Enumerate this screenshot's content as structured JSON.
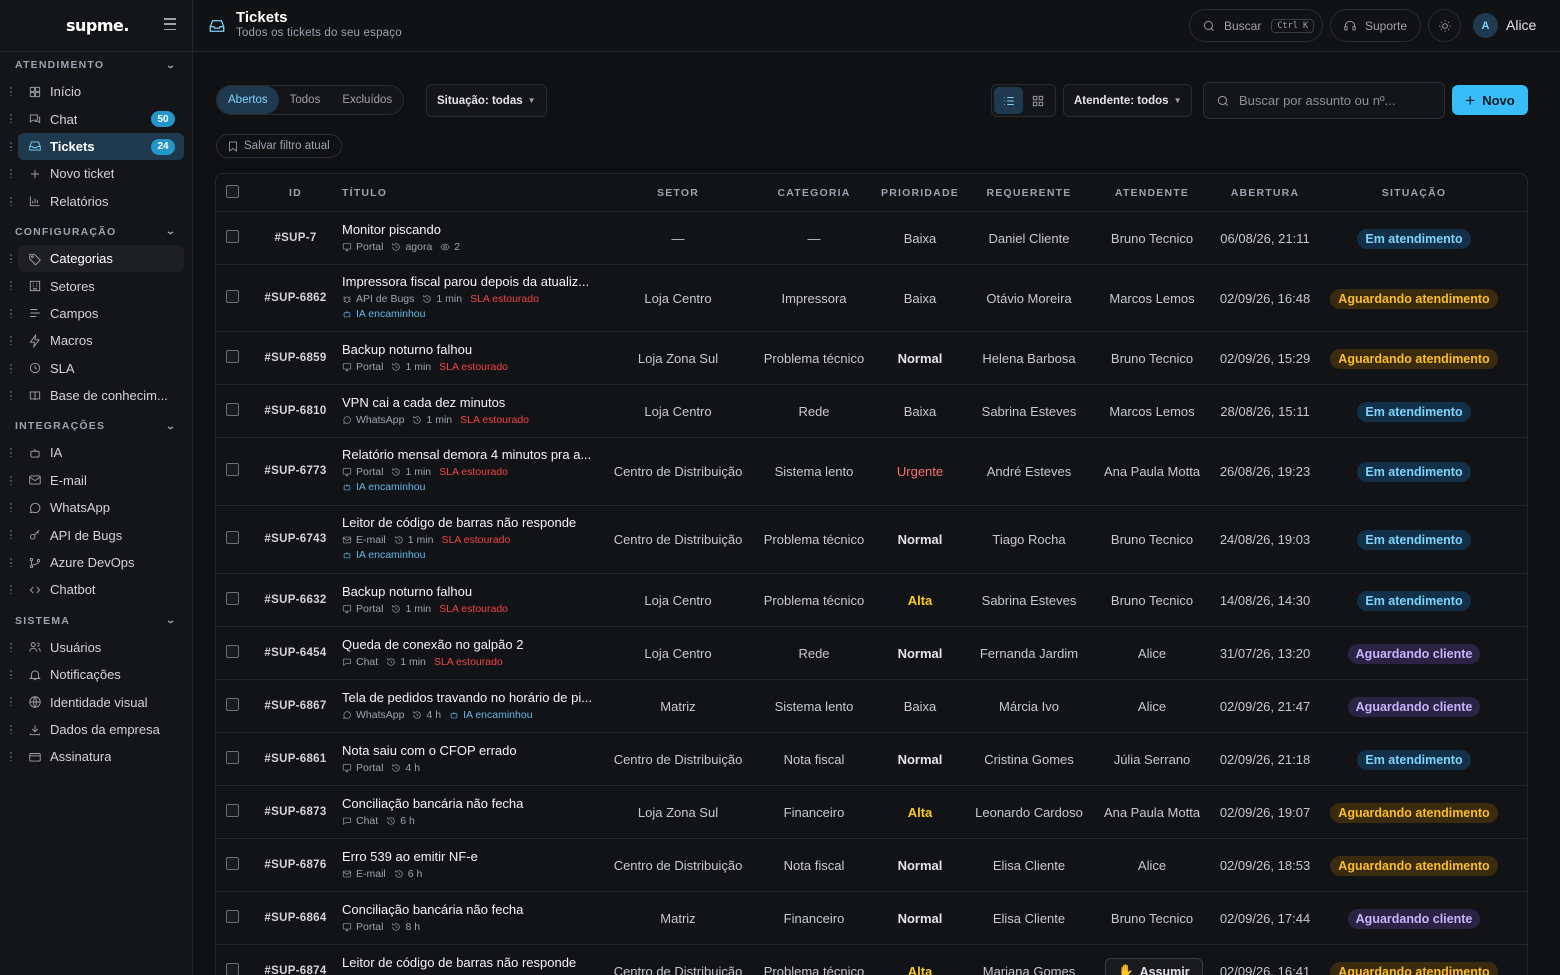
{
  "app": {
    "logo": "supme."
  },
  "sidebar": {
    "sections": [
      {
        "title": "ATENDIMENTO",
        "items": [
          {
            "label": "Início",
            "icon": "grid-icon"
          },
          {
            "label": "Chat",
            "icon": "chat-icon",
            "badge": "50"
          },
          {
            "label": "Tickets",
            "icon": "inbox-icon",
            "badge": "24",
            "active": true
          },
          {
            "label": "Novo ticket",
            "icon": "plus-icon"
          },
          {
            "label": "Relatórios",
            "icon": "bar-chart-icon"
          }
        ]
      },
      {
        "title": "CONFIGURAÇÃO",
        "items": [
          {
            "label": "Categorias",
            "icon": "tag-icon",
            "hover": true
          },
          {
            "label": "Setores",
            "icon": "building-icon"
          },
          {
            "label": "Campos",
            "icon": "fields-icon"
          },
          {
            "label": "Macros",
            "icon": "zap-icon"
          },
          {
            "label": "SLA",
            "icon": "clock-icon"
          },
          {
            "label": "Base de conhecim...",
            "icon": "book-icon"
          }
        ]
      },
      {
        "title": "INTEGRAÇÕES",
        "items": [
          {
            "label": "IA",
            "icon": "bot-icon"
          },
          {
            "label": "E-mail",
            "icon": "mail-icon"
          },
          {
            "label": "WhatsApp",
            "icon": "whatsapp-icon"
          },
          {
            "label": "API de Bugs",
            "icon": "key-icon"
          },
          {
            "label": "Azure DevOps",
            "icon": "git-branch-icon"
          },
          {
            "label": "Chatbot",
            "icon": "code-icon"
          }
        ]
      },
      {
        "title": "SISTEMA",
        "items": [
          {
            "label": "Usuários",
            "icon": "users-icon"
          },
          {
            "label": "Notificações",
            "icon": "bell-icon"
          },
          {
            "label": "Identidade visual",
            "icon": "globe-icon"
          },
          {
            "label": "Dados da empresa",
            "icon": "download-icon"
          },
          {
            "label": "Assinatura",
            "icon": "card-icon"
          }
        ]
      }
    ]
  },
  "header": {
    "title": "Tickets",
    "subtitle": "Todos os tickets do seu espaço",
    "search_label": "Buscar",
    "search_kbd": "Ctrl K",
    "support_label": "Suporte",
    "user_initial": "A",
    "user_name": "Alice"
  },
  "toolbar": {
    "tabs": [
      "Abertos",
      "Todos",
      "Excluídos"
    ],
    "status_filter": "Situação: todas",
    "agent_filter": "Atendente: todos",
    "search_placeholder": "Buscar por assunto ou nº...",
    "new_label": "Novo",
    "save_filter": "Salvar filtro atual"
  },
  "table": {
    "columns": [
      "ID",
      "TÍTULO",
      "SETOR",
      "CATEGORIA",
      "PRIORIDADE",
      "REQUERENTE",
      "ATENDENTE",
      "ABERTURA",
      "SITUAÇÃO"
    ],
    "rows": [
      {
        "id": "#SUP-7",
        "title": "Monitor piscando",
        "channel": "Portal",
        "time": "agora",
        "views": "2",
        "sla": "",
        "ia": "",
        "setor": "—",
        "categoria": "—",
        "prioridade": "Baixa",
        "requerente": "Daniel Cliente",
        "atendente": "Bruno Tecnico",
        "abertura": "06/08/26, 21:11",
        "situacao": "Em atendimento"
      },
      {
        "id": "#SUP-6862",
        "title": "Impressora fiscal parou depois da atualiz...",
        "channel": "API de Bugs",
        "time": "1 min",
        "sla": "SLA estourado",
        "ia": "IA encaminhou",
        "setor": "Loja Centro",
        "categoria": "Impressora",
        "prioridade": "Baixa",
        "requerente": "Otávio Moreira",
        "atendente": "Marcos Lemos",
        "abertura": "02/09/26, 16:48",
        "situacao": "Aguardando atendimento"
      },
      {
        "id": "#SUP-6859",
        "title": "Backup noturno falhou",
        "channel": "Portal",
        "time": "1 min",
        "sla": "SLA estourado",
        "ia": "",
        "setor": "Loja Zona Sul",
        "categoria": "Problema técnico",
        "prioridade": "Normal",
        "requerente": "Helena Barbosa",
        "atendente": "Bruno Tecnico",
        "abertura": "02/09/26, 15:29",
        "situacao": "Aguardando atendimento"
      },
      {
        "id": "#SUP-6810",
        "title": "VPN cai a cada dez minutos",
        "channel": "WhatsApp",
        "time": "1 min",
        "sla": "SLA estourado",
        "ia": "",
        "setor": "Loja Centro",
        "categoria": "Rede",
        "prioridade": "Baixa",
        "requerente": "Sabrina Esteves",
        "atendente": "Marcos Lemos",
        "abertura": "28/08/26, 15:11",
        "situacao": "Em atendimento"
      },
      {
        "id": "#SUP-6773",
        "title": "Relatório mensal demora 4 minutos pra a...",
        "channel": "Portal",
        "time": "1 min",
        "sla": "SLA estourado",
        "ia": "IA encaminhou",
        "setor": "Centro de Distribuição",
        "categoria": "Sistema lento",
        "prioridade": "Urgente",
        "requerente": "André Esteves",
        "atendente": "Ana Paula Motta",
        "abertura": "26/08/26, 19:23",
        "situacao": "Em atendimento"
      },
      {
        "id": "#SUP-6743",
        "title": "Leitor de código de barras não responde",
        "channel": "E-mail",
        "time": "1 min",
        "sla": "SLA estourado",
        "ia": "IA encaminhou",
        "setor": "Centro de Distribuição",
        "categoria": "Problema técnico",
        "prioridade": "Normal",
        "requerente": "Tiago Rocha",
        "atendente": "Bruno Tecnico",
        "abertura": "24/08/26, 19:03",
        "situacao": "Em atendimento"
      },
      {
        "id": "#SUP-6632",
        "title": "Backup noturno falhou",
        "channel": "Portal",
        "time": "1 min",
        "sla": "SLA estourado",
        "ia": "",
        "setor": "Loja Centro",
        "categoria": "Problema técnico",
        "prioridade": "Alta",
        "requerente": "Sabrina Esteves",
        "atendente": "Bruno Tecnico",
        "abertura": "14/08/26, 14:30",
        "situacao": "Em atendimento"
      },
      {
        "id": "#SUP-6454",
        "title": "Queda de conexão no galpão 2",
        "channel": "Chat",
        "time": "1 min",
        "sla": "SLA estourado",
        "ia": "",
        "setor": "Loja Centro",
        "categoria": "Rede",
        "prioridade": "Normal",
        "requerente": "Fernanda Jardim",
        "atendente": "Alice",
        "abertura": "31/07/26, 13:20",
        "situacao": "Aguardando cliente"
      },
      {
        "id": "#SUP-6867",
        "title": "Tela de pedidos travando no horário de pi...",
        "channel": "WhatsApp",
        "time": "4 h",
        "sla": "",
        "ia": "IA encaminhou",
        "ia_inline": true,
        "setor": "Matriz",
        "categoria": "Sistema lento",
        "prioridade": "Baixa",
        "requerente": "Márcia Ivo",
        "atendente": "Alice",
        "abertura": "02/09/26, 21:47",
        "situacao": "Aguardando cliente"
      },
      {
        "id": "#SUP-6861",
        "title": "Nota saiu com o CFOP errado",
        "channel": "Portal",
        "time": "4 h",
        "sla": "",
        "ia": "",
        "setor": "Centro de Distribuição",
        "categoria": "Nota fiscal",
        "prioridade": "Normal",
        "requerente": "Cristina Gomes",
        "atendente": "Júlia Serrano",
        "abertura": "02/09/26, 21:18",
        "situacao": "Em atendimento"
      },
      {
        "id": "#SUP-6873",
        "title": "Conciliação bancária não fecha",
        "channel": "Chat",
        "time": "6 h",
        "sla": "",
        "ia": "",
        "setor": "Loja Zona Sul",
        "categoria": "Financeiro",
        "prioridade": "Alta",
        "requerente": "Leonardo Cardoso",
        "atendente": "Ana Paula Motta",
        "abertura": "02/09/26, 19:07",
        "situacao": "Aguardando atendimento"
      },
      {
        "id": "#SUP-6876",
        "title": "Erro 539 ao emitir NF-e",
        "channel": "E-mail",
        "time": "6 h",
        "sla": "",
        "ia": "",
        "setor": "Centro de Distribuição",
        "categoria": "Nota fiscal",
        "prioridade": "Normal",
        "requerente": "Elisa Cliente",
        "atendente": "Alice",
        "abertura": "02/09/26, 18:53",
        "situacao": "Aguardando atendimento"
      },
      {
        "id": "#SUP-6864",
        "title": "Conciliação bancária não fecha",
        "channel": "Portal",
        "time": "8 h",
        "sla": "",
        "ia": "",
        "setor": "Matriz",
        "categoria": "Financeiro",
        "prioridade": "Normal",
        "requerente": "Elisa Cliente",
        "atendente": "Bruno Tecnico",
        "abertura": "02/09/26, 17:44",
        "situacao": "Aguardando cliente"
      },
      {
        "id": "#SUP-6874",
        "title": "Leitor de código de barras não responde",
        "channel": "",
        "time": "",
        "sla": "",
        "ia": "",
        "setor": "Centro de Distribuição",
        "categoria": "Problema técnico",
        "prioridade": "Alta",
        "requerente": "Mariana Gomes",
        "atendente": "",
        "assumir": "Assumir",
        "abertura": "02/09/26, 16:41",
        "situacao": "Aguardando atendimento"
      }
    ]
  },
  "colors": {
    "accent": "#38bdf8",
    "sla": "#ef4444",
    "alta": "#facc15",
    "urgente": "#f87171"
  }
}
